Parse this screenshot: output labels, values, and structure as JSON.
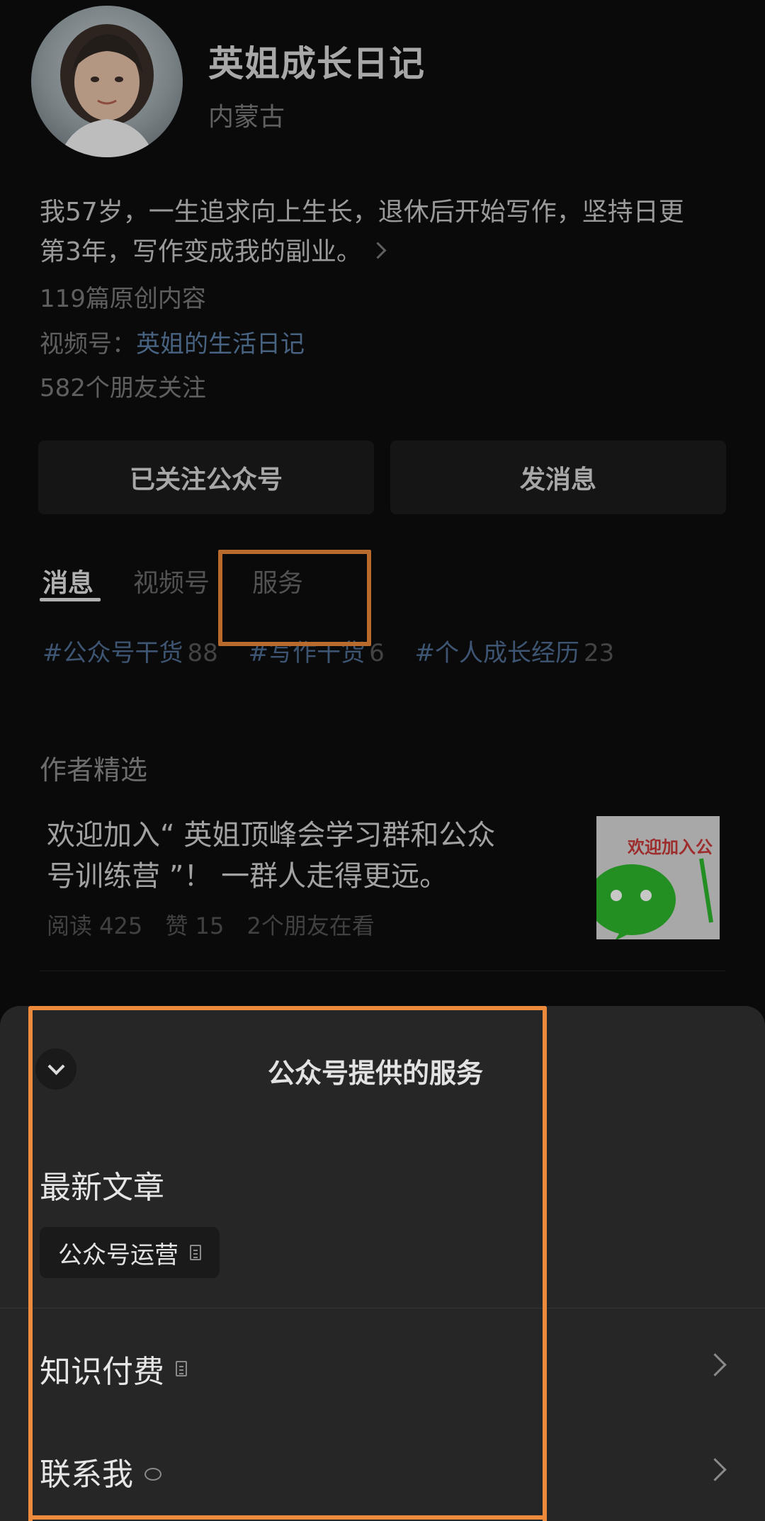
{
  "profile": {
    "name": "英姐成长日记",
    "region": "内蒙古",
    "bio_line1": "我57岁，一生追求向上生长，退休后开始写作，坚持日更",
    "bio_line2": "第3年，写作变成我的副业。",
    "original_count": "119篇原创内容",
    "channel_prefix": "视频号：",
    "channel_name": "英姐的生活日记",
    "friends_following": "582个朋友关注"
  },
  "buttons": {
    "followed": "已关注公众号",
    "message": "发消息"
  },
  "tabs": [
    {
      "label": "消息",
      "active": true
    },
    {
      "label": "视频号",
      "active": false
    },
    {
      "label": "服务",
      "active": false
    }
  ],
  "hashtags": [
    {
      "name": "#公众号干货",
      "count": "88"
    },
    {
      "name": "#写作干货",
      "count": "6"
    },
    {
      "name": "#个人成长经历",
      "count": "23"
    }
  ],
  "picks": {
    "section_title": "作者精选",
    "article": {
      "title_line1": "欢迎加入“ 英姐顶峰会学习群和公众",
      "title_line2": "号训练营 ”！ 一群人走得更远。",
      "reads": "阅读 425",
      "likes": "赞 15",
      "friends_reading": "2个朋友在看",
      "thumb_text": "欢迎加入公"
    }
  },
  "sheet": {
    "title": "公众号提供的服务",
    "latest_label": "最新文章",
    "latest_chip": "公众号运营",
    "rows": [
      {
        "label": "知识付费",
        "icon": "document-icon"
      },
      {
        "label": "联系我",
        "icon": "chat-bubble-icon"
      }
    ]
  },
  "colors": {
    "highlight": "#ed8a3b",
    "link": "#5d7fa6",
    "sheet_bg": "#262626",
    "wechat_green": "#2eb82e"
  }
}
